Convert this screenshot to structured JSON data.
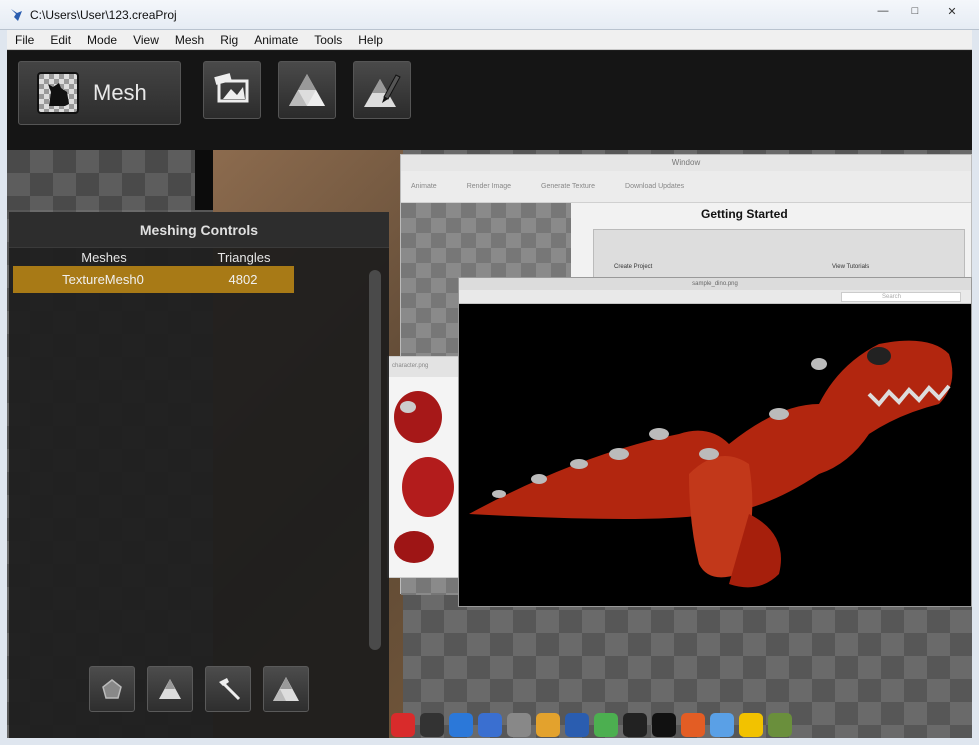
{
  "window": {
    "title": "C:\\Users\\User\\123.creaProj",
    "controls": [
      "minimize-icon",
      "maximize-icon",
      "close-icon"
    ],
    "min_glyph": "—",
    "max_glyph": "□",
    "close_glyph": "✕"
  },
  "menu": [
    "File",
    "Edit",
    "Mode",
    "View",
    "Mesh",
    "Rig",
    "Animate",
    "Tools",
    "Help"
  ],
  "toolbar": {
    "mode_label": "Mesh",
    "tools": [
      "image-import-icon",
      "mesh-triangles-icon",
      "mesh-edit-icon"
    ]
  },
  "meshing_controls": {
    "title": "Meshing Controls",
    "columns": [
      "Meshes",
      "Triangles"
    ],
    "rows": [
      {
        "mesh": "TextureMesh0",
        "triangles": "4802"
      }
    ],
    "bottom_tools": [
      "pentagon-icon",
      "triangle-icon",
      "hammer-icon",
      "mesh-triangles-icon"
    ]
  },
  "background_window": {
    "title": "Window",
    "heading": "Getting Started",
    "create": "Create Project",
    "tutorials": "View Tutorials",
    "toolbar_items": [
      "Animate",
      "Render Image",
      "Generate Texture",
      "Download Updates"
    ]
  },
  "side_window": {
    "title": "character.png"
  },
  "dino_window": {
    "title": "sample_dino.png",
    "search": "Search"
  },
  "colors": {
    "selection": "#a87a16",
    "panel": "#1c1c1c"
  }
}
